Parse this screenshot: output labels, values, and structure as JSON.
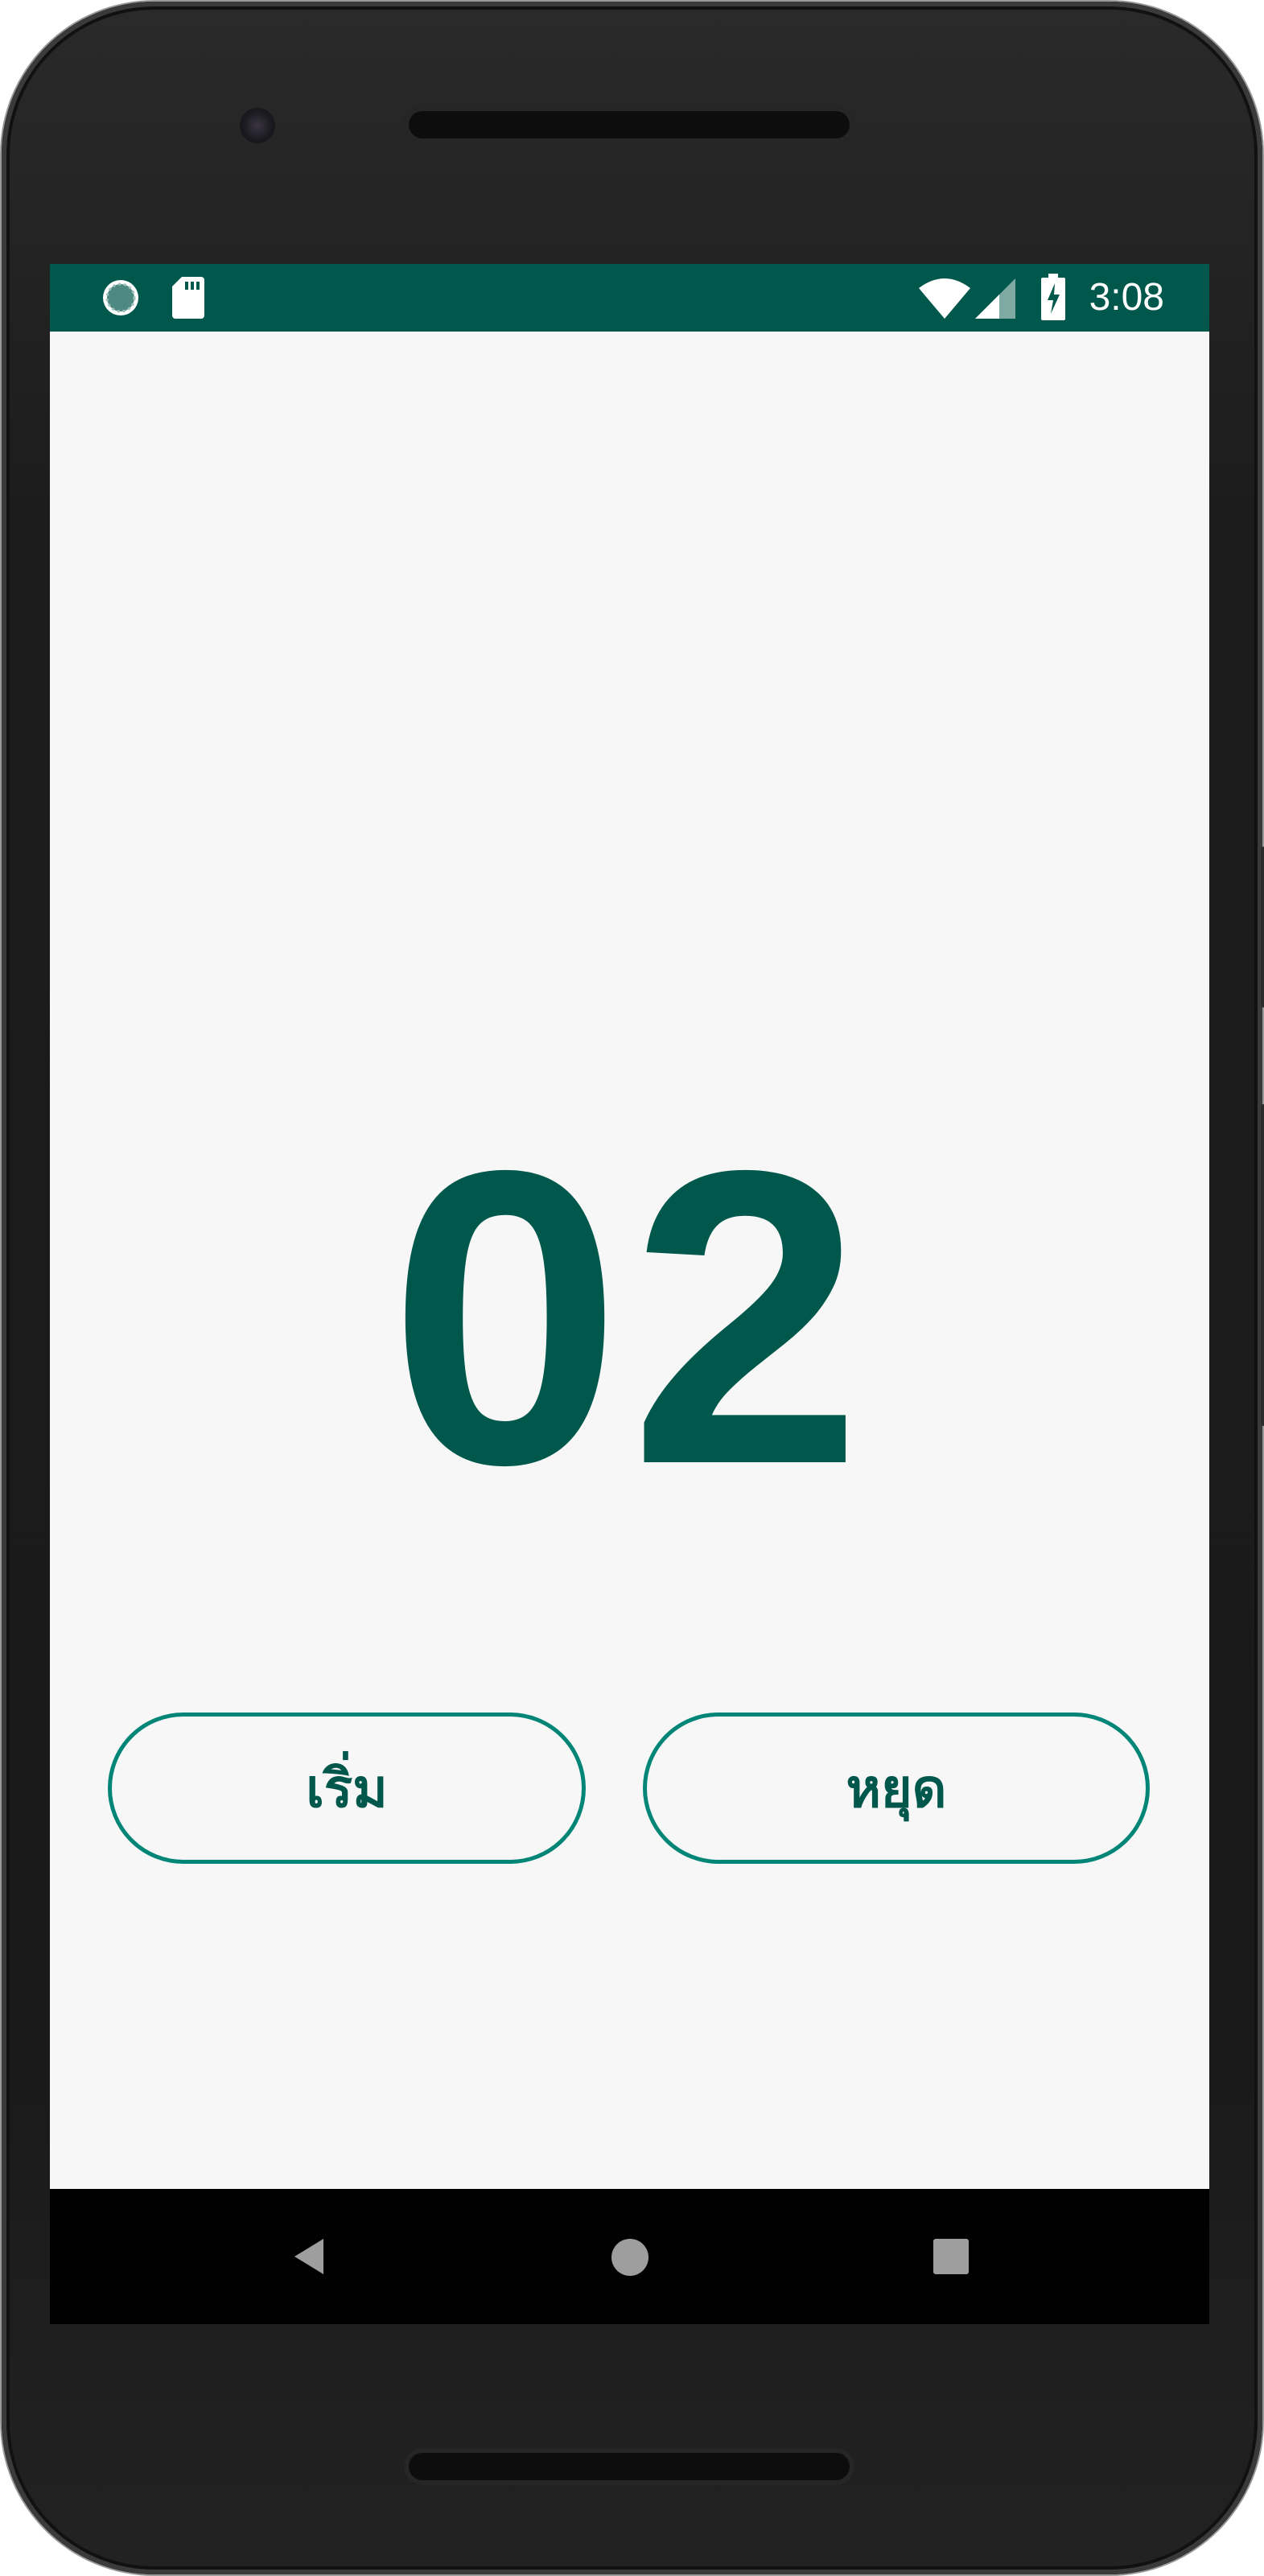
{
  "status_bar": {
    "time": "3:08",
    "color": "#00574b",
    "left_icons": [
      "sync-icon",
      "sd-card-icon"
    ],
    "right_icons": [
      "wifi-icon",
      "cell-signal-icon",
      "battery-charging-icon"
    ]
  },
  "counter": {
    "value": "02",
    "color": "#00574b"
  },
  "buttons": {
    "start_label": "เริ่ม",
    "stop_label": "หยุด",
    "border_color": "#008577"
  },
  "nav_bar": {
    "items": [
      "back-icon",
      "home-icon",
      "recents-icon"
    ]
  }
}
